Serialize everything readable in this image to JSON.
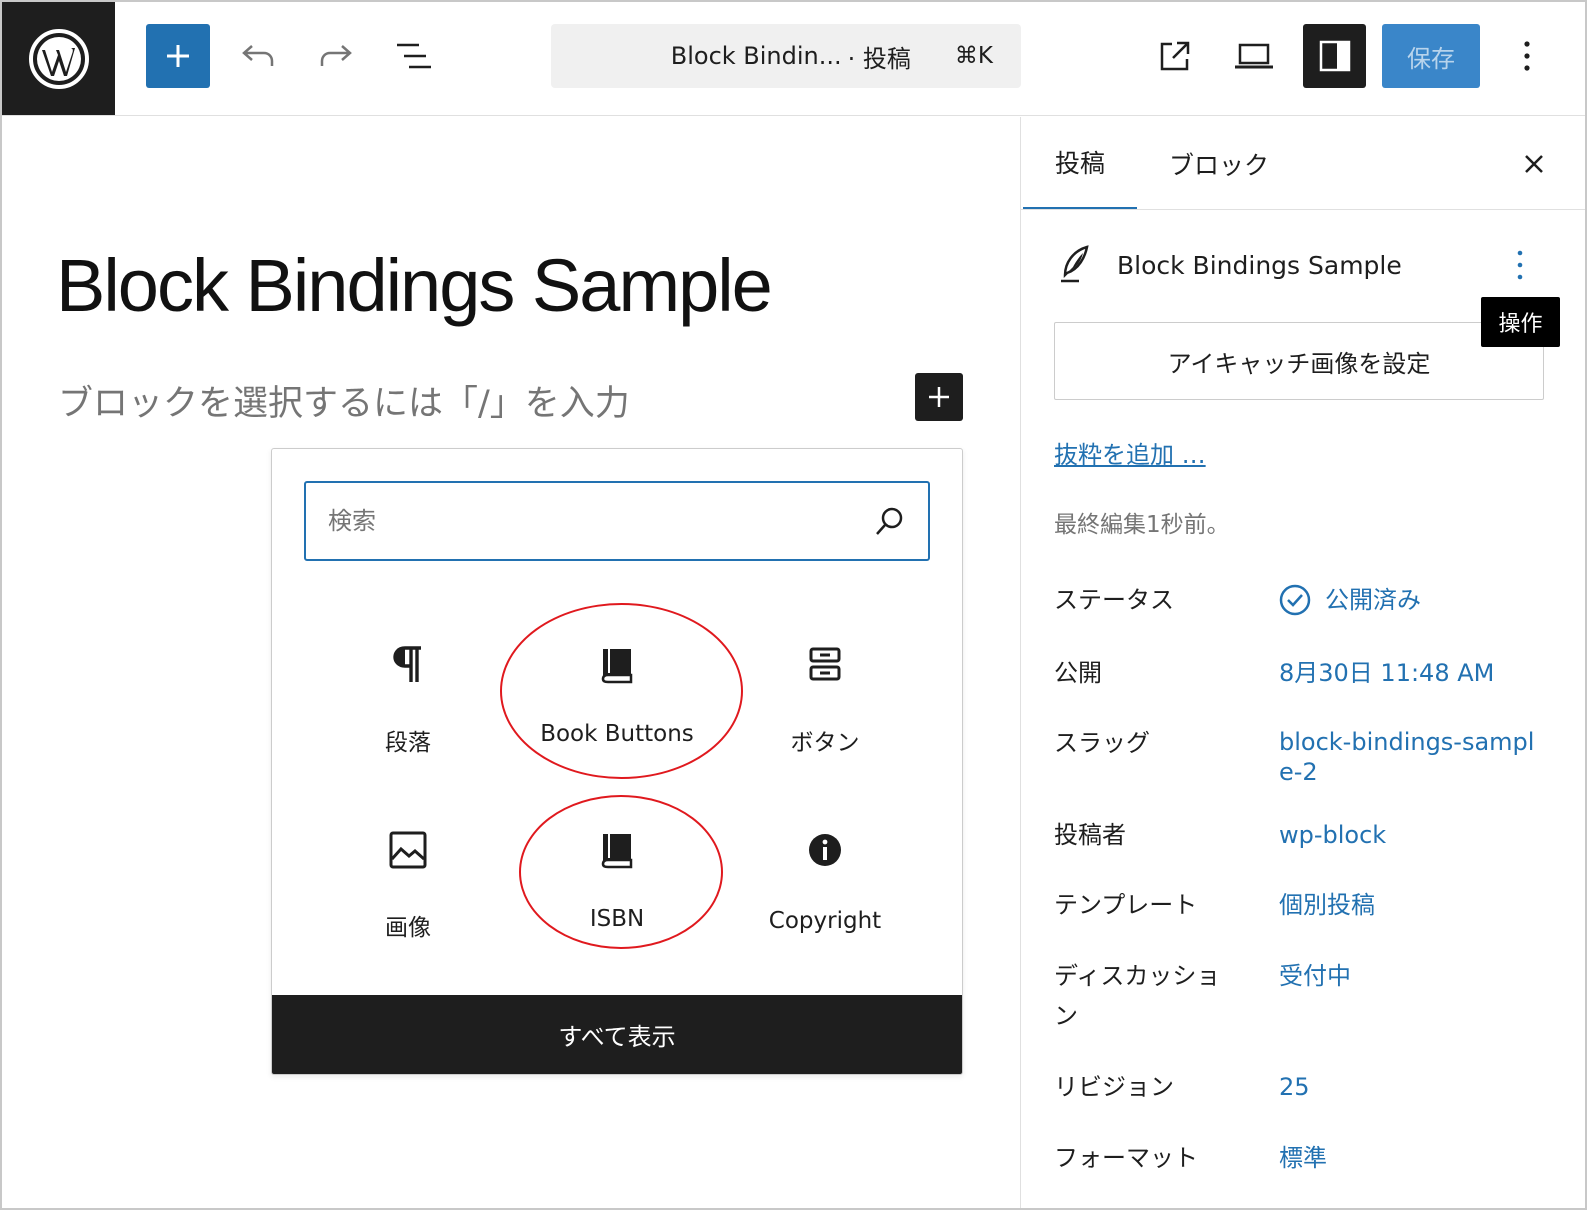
{
  "toolbar": {
    "doc_title": "Block Bindin...",
    "doc_type": "· 投稿",
    "shortcut": "⌘K",
    "save_label": "保存"
  },
  "editor": {
    "post_title": "Block Bindings Sample",
    "placeholder": "ブロックを選択するには「/」を入力"
  },
  "inserter": {
    "search_placeholder": "検索",
    "blocks": [
      {
        "label": "段落",
        "icon": "paragraph-icon"
      },
      {
        "label": "Book Buttons",
        "icon": "book-icon"
      },
      {
        "label": "ボタン",
        "icon": "buttons-icon"
      },
      {
        "label": "画像",
        "icon": "image-icon"
      },
      {
        "label": "ISBN",
        "icon": "book-icon"
      },
      {
        "label": "Copyright",
        "icon": "info-icon"
      }
    ],
    "show_all": "すべて表示"
  },
  "sidebar": {
    "tabs": [
      "投稿",
      "ブロック"
    ],
    "post_card_title": "Block Bindings Sample",
    "actions_tooltip": "操作",
    "featured_image": "アイキャッチ画像を設定",
    "add_excerpt": "抜粋を追加 …",
    "last_edited": "最終編集1秒前。",
    "rows": [
      {
        "label": "ステータス",
        "value": "公開済み"
      },
      {
        "label": "公開",
        "value": "8月30日 11:48 AM"
      },
      {
        "label": "スラッグ",
        "value": "block-bindings-sample-2"
      },
      {
        "label": "投稿者",
        "value": "wp-block"
      },
      {
        "label": "テンプレート",
        "value": "個別投稿"
      },
      {
        "label": "ディスカッション",
        "value": "受付中"
      },
      {
        "label": "リビジョン",
        "value": "25"
      },
      {
        "label": "フォーマット",
        "value": "標準"
      }
    ]
  },
  "colors": {
    "accent": "#2271b1",
    "dark": "#1e1e1e",
    "highlight_circle": "#e0191e"
  }
}
